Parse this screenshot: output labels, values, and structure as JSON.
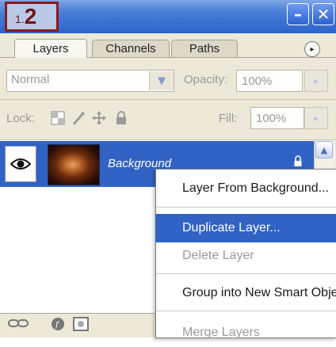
{
  "step_badge": {
    "small": "1.",
    "big": "2"
  },
  "window_buttons": {
    "minimize": "–",
    "close": "✕"
  },
  "tabs": {
    "layers": "Layers",
    "channels": "Channels",
    "paths": "Paths",
    "menu_arrow": "▸"
  },
  "blend": {
    "mode": "Normal",
    "dropdown_arrow": "▼",
    "opacity_label": "Opacity:",
    "opacity_value": "100%",
    "arrow": "▸"
  },
  "lock": {
    "label": "Lock:",
    "fill_label": "Fill:",
    "fill_value": "100%",
    "arrow": "▸"
  },
  "layer": {
    "name": "Background",
    "eye": "👁",
    "lock_icon": "🔒"
  },
  "scroll": {
    "up": "▲"
  },
  "context_menu": {
    "items": [
      {
        "label": "Layer From Background...",
        "state": "normal"
      },
      {
        "label": "Duplicate Layer...",
        "state": "selected"
      },
      {
        "label": "Delete Layer",
        "state": "disabled"
      },
      {
        "label": "Group into New Smart Object",
        "state": "normal"
      },
      {
        "label": "Merge Layers",
        "state": "disabled"
      }
    ]
  },
  "colors": {
    "selection": "#3163c5",
    "title_bar": "#2b63c9",
    "badge_border": "#8b1a1a"
  }
}
